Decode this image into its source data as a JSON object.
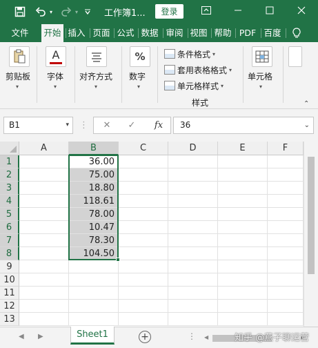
{
  "title_bar": {
    "doc_title": "工作簿1...",
    "login_label": "登录"
  },
  "tabs": [
    {
      "label": "文件"
    },
    {
      "label": "开始"
    },
    {
      "label": "插入"
    },
    {
      "label": "页面"
    },
    {
      "label": "公式"
    },
    {
      "label": "数据"
    },
    {
      "label": "审阅"
    },
    {
      "label": "视图"
    },
    {
      "label": "帮助"
    },
    {
      "label": "PDF"
    },
    {
      "label": "百度"
    }
  ],
  "active_tab": "开始",
  "ribbon": {
    "clipboard_label": "剪贴板",
    "font_label": "字体",
    "align_label": "对齐方式",
    "number_label": "数字",
    "number_icon_text": "%",
    "font_icon_text": "A",
    "styles": {
      "conditional_format": "条件格式",
      "table_format": "套用表格格式",
      "cell_style": "单元格样式",
      "group_label": "样式"
    },
    "cells_label": "单元格"
  },
  "formula_bar": {
    "name_box": "B1",
    "fx_label": "fx",
    "value": "36"
  },
  "grid": {
    "columns": [
      "A",
      "B",
      "C",
      "D",
      "E",
      "F"
    ],
    "rows": [
      "1",
      "2",
      "3",
      "4",
      "5",
      "6",
      "7",
      "8",
      "9",
      "10",
      "11",
      "12",
      "13"
    ],
    "column_b_values": [
      "36.00",
      "75.00",
      "18.80",
      "118.61",
      "78.00",
      "10.47",
      "78.30",
      "104.50"
    ],
    "selected_range": "B1:B8"
  },
  "sheets": [
    {
      "label": "Sheet1"
    }
  ],
  "watermark": "知乎 @燕子聊运营",
  "colors": {
    "excel_green": "#217346",
    "selection_gray": "#d3d3d3"
  }
}
